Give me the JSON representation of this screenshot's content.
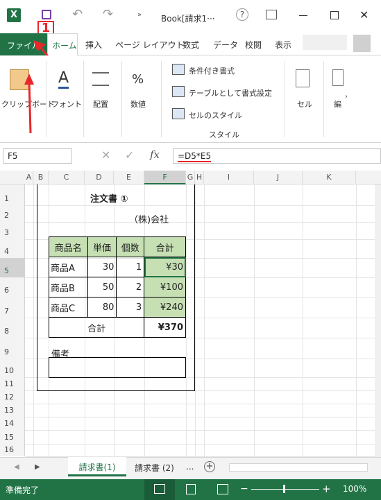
{
  "titlebar": {
    "title": "Book[請求1···",
    "question": "?",
    "step_badge": "1"
  },
  "tabs": {
    "file": "ファイル",
    "home": "ホーム",
    "insert": "挿入",
    "layout": "ページ レイアウト",
    "formulas": "数式",
    "data": "データ",
    "review": "校閲",
    "view": "表示"
  },
  "ribbon": {
    "clipboard": "クリップボード",
    "font": "フォント",
    "alignment": "配置",
    "number": "数値",
    "number_icon": "%",
    "font_icon": "A",
    "cond_format": "条件付き書式",
    "as_table": "テーブルとして書式設定",
    "cell_styles": "セルのスタイル",
    "styles_group": "スタイル",
    "cells": "セル",
    "edit": "編"
  },
  "formula": {
    "name_box": "F5",
    "fx": "fx",
    "formula": "=D5*E5"
  },
  "grid": {
    "columns": [
      "A",
      "B",
      "C",
      "D",
      "E",
      "F",
      "G",
      "H",
      "I",
      "J",
      "K"
    ],
    "rows": [
      "1",
      "2",
      "3",
      "4",
      "5",
      "6",
      "7",
      "8",
      "9",
      "10",
      "11",
      "12",
      "13",
      "14",
      "15",
      "16"
    ]
  },
  "order": {
    "title": "注文書 ①",
    "company": "（株)会社",
    "headers": [
      "商品名",
      "単価",
      "個数",
      "合計"
    ],
    "rows": [
      [
        "商品A",
        "30",
        "1",
        "¥30"
      ],
      [
        "商品B",
        "50",
        "2",
        "¥100"
      ],
      [
        "商品C",
        "80",
        "3",
        "¥240"
      ]
    ],
    "total_label": "合計",
    "total_value": "¥370",
    "notes_label": "備考"
  },
  "sheets": {
    "active": "請求書(1)",
    "other": "請求書 (2)",
    "more": "...",
    "add": "+"
  },
  "status": {
    "ready": "準備完了",
    "zoom": "100%",
    "minus": "−",
    "plus": "+"
  },
  "colors": {
    "excel_green": "#217346",
    "header_fill": "#c6e0b4",
    "annotation_red": "#e8272c"
  }
}
